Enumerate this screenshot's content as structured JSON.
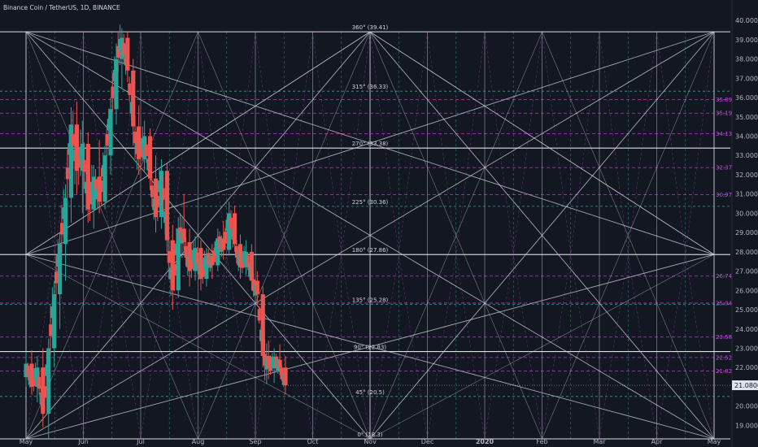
{
  "header": {
    "title": "Binance Coin / TetherUS, 1D, BINANCE"
  },
  "price_axis": {
    "ticks": [
      "40.0000",
      "39.0000",
      "38.0000",
      "37.0000",
      "36.0000",
      "35.0000",
      "34.0000",
      "33.0000",
      "32.0000",
      "31.0000",
      "30.0000",
      "29.0000",
      "28.0000",
      "27.0000",
      "26.0000",
      "25.0000",
      "24.0000",
      "23.0000",
      "22.0000",
      "21.0000",
      "20.0000",
      "19.0000"
    ],
    "current_price": "21.0800",
    "current_price_color": "#e0e3eb"
  },
  "time_axis": {
    "labels": [
      "May",
      "Jun",
      "Jul",
      "Aug",
      "Sep",
      "Oct",
      "Nov",
      "Dec",
      "2020",
      "Feb",
      "Mar",
      "Apr",
      "May"
    ]
  },
  "colors": {
    "background": "#131722",
    "up": "#26a69a",
    "down": "#ef5350",
    "grid_major": "#e0e3eb",
    "teal_level": "#4db6ac",
    "magenta_level": "#c04fd6"
  },
  "chart_data": {
    "type": "candlestick",
    "title": "Binance Coin / TetherUS, 1D, BINANCE",
    "ylim": [
      18.3,
      40.3
    ],
    "x_range": [
      "2019-05-01",
      "2020-05-01"
    ],
    "range_low": 18.3,
    "range_high": 39.41,
    "range_start": "2019-05-01",
    "range_end": "2020-05-01",
    "angle_levels": [
      {
        "label": "360° (39.41)",
        "value": 39.41
      },
      {
        "label": "315° (36.33)",
        "value": 36.33
      },
      {
        "label": "270° (33.38)",
        "value": 33.38
      },
      {
        "label": "225° (30.36)",
        "value": 30.36
      },
      {
        "label": "180° (27.86)",
        "value": 27.86
      },
      {
        "label": "135° (25.28)",
        "value": 25.28
      },
      {
        "label": "90° (22.83)",
        "value": 22.83
      },
      {
        "label": "45° (20.5)",
        "value": 20.5
      },
      {
        "label": "0° (18.3)",
        "value": 18.3
      }
    ],
    "price_levels": [
      {
        "label": "35.89",
        "value": 35.89,
        "color": "magenta"
      },
      {
        "label": "35.19",
        "value": 35.19,
        "color": "magenta"
      },
      {
        "label": "34.13",
        "value": 34.13,
        "color": "magenta"
      },
      {
        "label": "32.37",
        "value": 32.37,
        "color": "magenta"
      },
      {
        "label": "30.97",
        "value": 30.97,
        "color": "magenta"
      },
      {
        "label": "26.74",
        "value": 26.74,
        "color": "magenta"
      },
      {
        "label": "25.34",
        "value": 25.34,
        "color": "magenta"
      },
      {
        "label": "23.58",
        "value": 23.58,
        "color": "magenta"
      },
      {
        "label": "22.52",
        "value": 22.52,
        "color": "magenta"
      },
      {
        "label": "21.82",
        "value": 21.82,
        "color": "magenta"
      }
    ],
    "current_price": 21.08,
    "candles": [
      {
        "d": "2019-05-01",
        "o": 21.5,
        "h": 22.8,
        "l": 21.0,
        "c": 22.2
      },
      {
        "d": "2019-05-04",
        "o": 22.2,
        "h": 22.9,
        "l": 20.6,
        "c": 21.0
      },
      {
        "d": "2019-05-07",
        "o": 21.0,
        "h": 22.6,
        "l": 20.2,
        "c": 22.0
      },
      {
        "d": "2019-05-10",
        "o": 22.0,
        "h": 23.0,
        "l": 18.9,
        "c": 19.6
      },
      {
        "d": "2019-05-13",
        "o": 19.6,
        "h": 23.5,
        "l": 18.3,
        "c": 23.0
      },
      {
        "d": "2019-05-16",
        "o": 23.0,
        "h": 26.5,
        "l": 22.0,
        "c": 25.8
      },
      {
        "d": "2019-05-19",
        "o": 25.8,
        "h": 29.0,
        "l": 24.0,
        "c": 28.4
      },
      {
        "d": "2019-05-22",
        "o": 28.4,
        "h": 31.5,
        "l": 26.5,
        "c": 30.8
      },
      {
        "d": "2019-05-25",
        "o": 30.8,
        "h": 35.5,
        "l": 29.5,
        "c": 34.6
      },
      {
        "d": "2019-05-28",
        "o": 34.6,
        "h": 35.8,
        "l": 31.0,
        "c": 32.2
      },
      {
        "d": "2019-05-31",
        "o": 32.2,
        "h": 34.8,
        "l": 30.0,
        "c": 33.6
      },
      {
        "d": "2019-06-03",
        "o": 33.6,
        "h": 34.2,
        "l": 29.5,
        "c": 30.2
      },
      {
        "d": "2019-06-06",
        "o": 30.2,
        "h": 32.5,
        "l": 29.2,
        "c": 31.9
      },
      {
        "d": "2019-06-09",
        "o": 31.9,
        "h": 33.8,
        "l": 30.0,
        "c": 30.6
      },
      {
        "d": "2019-06-12",
        "o": 30.6,
        "h": 33.5,
        "l": 30.2,
        "c": 33.0
      },
      {
        "d": "2019-06-15",
        "o": 33.0,
        "h": 36.0,
        "l": 32.0,
        "c": 35.4
      },
      {
        "d": "2019-06-18",
        "o": 35.4,
        "h": 38.8,
        "l": 34.6,
        "c": 38.0
      },
      {
        "d": "2019-06-21",
        "o": 38.0,
        "h": 39.6,
        "l": 36.5,
        "c": 39.1
      },
      {
        "d": "2019-06-24",
        "o": 39.1,
        "h": 39.4,
        "l": 36.8,
        "c": 37.4
      },
      {
        "d": "2019-06-27",
        "o": 37.4,
        "h": 38.0,
        "l": 33.5,
        "c": 34.5
      },
      {
        "d": "2019-06-30",
        "o": 34.5,
        "h": 35.6,
        "l": 32.0,
        "c": 32.8
      },
      {
        "d": "2019-07-03",
        "o": 32.8,
        "h": 34.8,
        "l": 32.2,
        "c": 34.0
      },
      {
        "d": "2019-07-06",
        "o": 34.0,
        "h": 34.4,
        "l": 31.2,
        "c": 31.8
      },
      {
        "d": "2019-07-09",
        "o": 31.8,
        "h": 33.0,
        "l": 29.0,
        "c": 29.8
      },
      {
        "d": "2019-07-12",
        "o": 29.8,
        "h": 32.8,
        "l": 29.2,
        "c": 32.2
      },
      {
        "d": "2019-07-15",
        "o": 32.2,
        "h": 32.6,
        "l": 28.0,
        "c": 28.6
      },
      {
        "d": "2019-07-18",
        "o": 28.6,
        "h": 29.4,
        "l": 25.0,
        "c": 26.0
      },
      {
        "d": "2019-07-21",
        "o": 26.0,
        "h": 29.8,
        "l": 25.6,
        "c": 29.2
      },
      {
        "d": "2019-07-24",
        "o": 29.2,
        "h": 31.0,
        "l": 28.0,
        "c": 28.5
      },
      {
        "d": "2019-07-27",
        "o": 28.5,
        "h": 29.2,
        "l": 26.2,
        "c": 27.0
      },
      {
        "d": "2019-07-30",
        "o": 27.0,
        "h": 28.8,
        "l": 26.5,
        "c": 28.2
      },
      {
        "d": "2019-08-02",
        "o": 28.2,
        "h": 28.6,
        "l": 26.0,
        "c": 26.6
      },
      {
        "d": "2019-08-05",
        "o": 26.6,
        "h": 28.2,
        "l": 26.2,
        "c": 27.8
      },
      {
        "d": "2019-08-08",
        "o": 27.8,
        "h": 28.4,
        "l": 26.6,
        "c": 27.3
      },
      {
        "d": "2019-08-11",
        "o": 27.3,
        "h": 29.2,
        "l": 27.0,
        "c": 28.7
      },
      {
        "d": "2019-08-14",
        "o": 28.7,
        "h": 29.6,
        "l": 27.6,
        "c": 28.1
      },
      {
        "d": "2019-08-17",
        "o": 28.1,
        "h": 30.6,
        "l": 27.8,
        "c": 30.0
      },
      {
        "d": "2019-08-20",
        "o": 30.0,
        "h": 30.4,
        "l": 28.0,
        "c": 28.4
      },
      {
        "d": "2019-08-23",
        "o": 28.4,
        "h": 28.9,
        "l": 26.6,
        "c": 27.2
      },
      {
        "d": "2019-08-26",
        "o": 27.2,
        "h": 28.6,
        "l": 26.8,
        "c": 28.0
      },
      {
        "d": "2019-08-29",
        "o": 28.0,
        "h": 28.4,
        "l": 26.0,
        "c": 26.5
      },
      {
        "d": "2019-09-01",
        "o": 26.5,
        "h": 27.0,
        "l": 25.2,
        "c": 25.8
      },
      {
        "d": "2019-09-04",
        "o": 25.8,
        "h": 26.2,
        "l": 22.0,
        "c": 22.6
      },
      {
        "d": "2019-09-07",
        "o": 22.6,
        "h": 23.4,
        "l": 21.4,
        "c": 22.0
      },
      {
        "d": "2019-09-10",
        "o": 22.0,
        "h": 23.0,
        "l": 21.2,
        "c": 22.4
      },
      {
        "d": "2019-09-13",
        "o": 22.4,
        "h": 23.2,
        "l": 21.6,
        "c": 22.0
      },
      {
        "d": "2019-09-16",
        "o": 22.0,
        "h": 22.6,
        "l": 20.6,
        "c": 21.08
      }
    ]
  }
}
